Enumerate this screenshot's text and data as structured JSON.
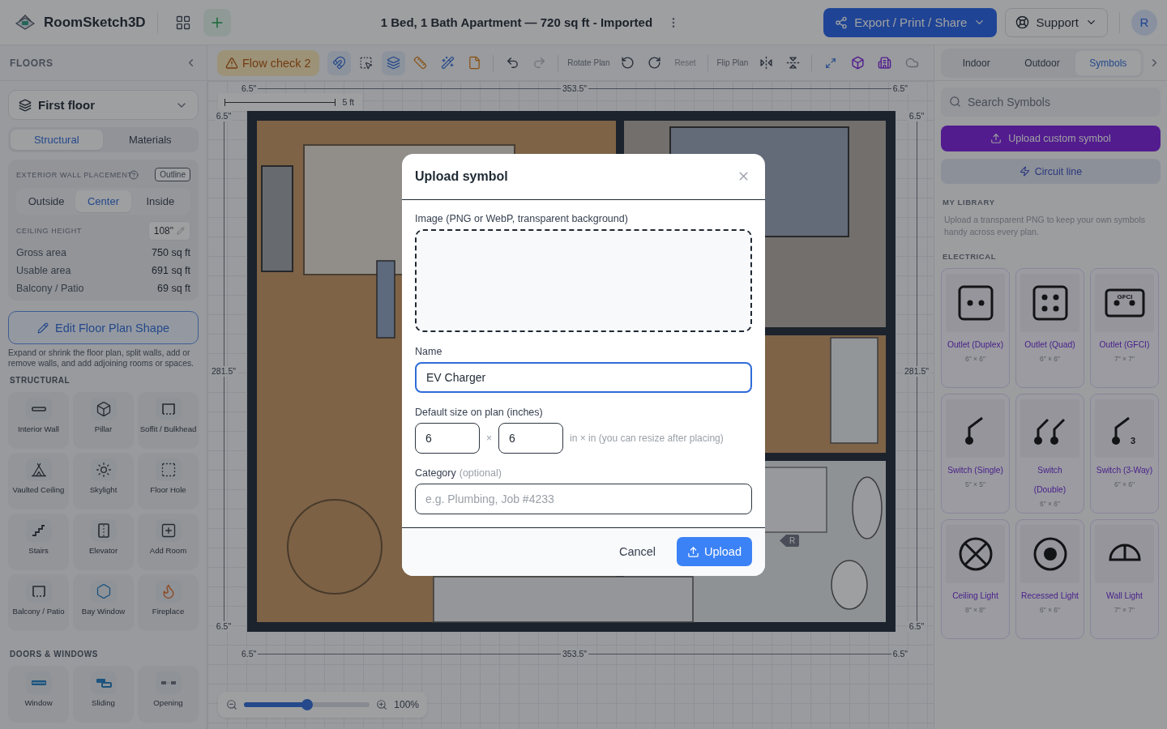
{
  "header": {
    "app_name": "RoomSketch3D",
    "title": "1 Bed, 1 Bath Apartment — 720 sq ft - Imported",
    "export_button": "Export / Print / Share",
    "support_button": "Support",
    "avatar": "R"
  },
  "toolbar": {
    "flow_check": "Flow check 2",
    "tools": [
      {
        "on": true
      },
      {
        "on": false
      },
      {
        "on": true
      },
      {
        "on": false
      },
      {
        "on": false
      },
      {
        "on": false
      }
    ],
    "undo": {
      "disabled": false
    },
    "redo": {
      "disabled": true
    },
    "rotate_label": "Rotate Plan",
    "reset": {
      "label": "Reset",
      "disabled": true
    },
    "flip_label": "Flip Plan"
  },
  "sidebar": {
    "heading": "FLOORS",
    "floor_select": "First floor",
    "tabs": [
      {
        "label": "Structural",
        "selected": true
      },
      {
        "label": "Materials",
        "selected": false
      }
    ],
    "wall_placement": {
      "label": "EXTERIOR WALL PLACEMENT",
      "outline_button": "Outline",
      "options": [
        {
          "label": "Outside",
          "selected": false
        },
        {
          "label": "Center",
          "selected": true
        },
        {
          "label": "Inside",
          "selected": false
        }
      ]
    },
    "ceiling": {
      "label": "CEILING HEIGHT",
      "value": "108\""
    },
    "stats": [
      {
        "label": "Gross area",
        "value": "750 sq ft"
      },
      {
        "label": "Usable area",
        "value": "691 sq ft"
      },
      {
        "label": "Balcony / Patio",
        "value": "69 sq ft"
      }
    ],
    "edit_button": "Edit Floor Plan Shape",
    "edit_help": "Expand or shrink the floor plan, split walls, add or remove walls, and add adjoining rooms or spaces.",
    "sections": [
      {
        "title": "STRUCTURAL",
        "items": [
          "Interior Wall",
          "Pillar",
          "Soffit / Bulkhead",
          "Vaulted Ceiling",
          "Skylight",
          "Floor Hole",
          "Stairs",
          "Elevator",
          "Add Room",
          "Balcony / Patio",
          "Bay Window",
          "Fireplace"
        ]
      },
      {
        "title": "DOORS & WINDOWS",
        "items": [
          "Window",
          "Sliding",
          "Opening"
        ]
      }
    ]
  },
  "canvas": {
    "scale_label": "5 ft",
    "dimensions": {
      "top": [
        "6.5\"",
        "353.5\"",
        "6.5\""
      ],
      "bottom": [
        "6.5\"",
        "353.5\"",
        "6.5\""
      ],
      "left": [
        "6.5\"",
        "281.5\"",
        "6.5\""
      ],
      "right": [
        "6.5\"",
        "281.5\"",
        "6.5\""
      ]
    },
    "marker": "R",
    "zoom": {
      "level": 0.5,
      "label": "100%"
    }
  },
  "symbols_panel": {
    "tabs": [
      {
        "label": "Indoor",
        "selected": false
      },
      {
        "label": "Outdoor",
        "selected": false
      },
      {
        "label": "Symbols",
        "selected": true
      }
    ],
    "search_placeholder": "Search Symbols",
    "upload_button": "Upload custom symbol",
    "circuit_button": "Circuit line",
    "library_title": "MY LIBRARY",
    "library_help": "Upload a transparent PNG to keep your own symbols handy across every plan.",
    "category": "ELECTRICAL",
    "symbols": [
      {
        "name": "Outlet (Duplex)",
        "size": "6\" × 6\""
      },
      {
        "name": "Outlet (Quad)",
        "size": "6\" × 6\""
      },
      {
        "name": "Outlet (GFCI)",
        "size": "7\" × 7\"",
        "badge": "GFCI"
      },
      {
        "name": "Switch (Single)",
        "size": "5\" × 5\""
      },
      {
        "name": "Switch (Double)",
        "size": "6\" × 6\""
      },
      {
        "name": "Switch (3-Way)",
        "size": "6\" × 6\"",
        "badge": "3"
      },
      {
        "name": "Ceiling Light",
        "size": "8\" × 8\""
      },
      {
        "name": "Recessed Light",
        "size": "6\" × 6\""
      },
      {
        "name": "Wall Light",
        "size": "7\" × 7\""
      }
    ]
  },
  "dialog": {
    "title": "Upload symbol",
    "image_label": "Image (PNG or WebP, transparent background)",
    "name_label": "Name",
    "name_field": {
      "value": "EV Charger",
      "focused": true
    },
    "size_label": "Default size on plan (inches)",
    "width_value": "6",
    "times": "×",
    "height_value": "6",
    "size_hint": "in × in (you can resize after placing)",
    "category_label": "Category",
    "category_note": "(optional)",
    "category_placeholder": "e.g. Plumbing, Job #4233",
    "cancel_button": "Cancel",
    "upload_button": "Upload"
  }
}
